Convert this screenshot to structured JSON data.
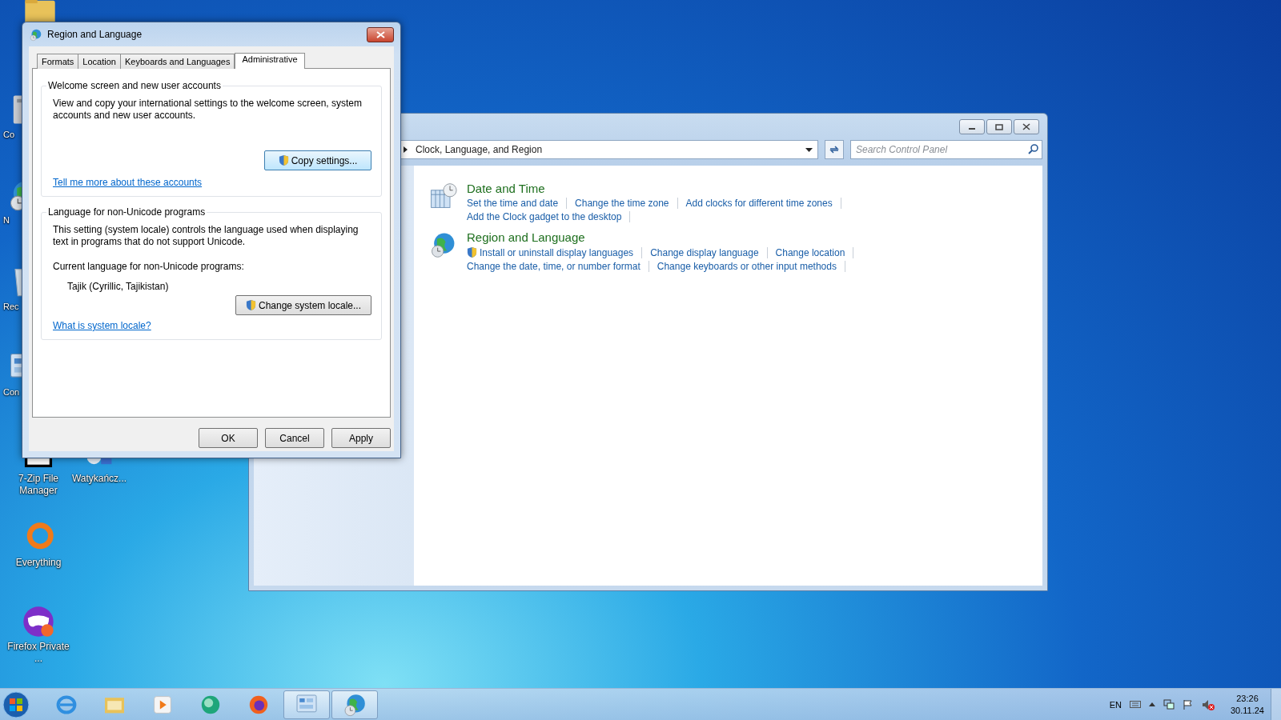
{
  "desktop_icons": [
    {
      "kind": "folder"
    },
    {
      "kind": "computer",
      "label": "Co"
    },
    {
      "kind": "globe",
      "label": "N"
    },
    {
      "kind": "bin",
      "label": "Rec"
    },
    {
      "kind": "panel",
      "label": "Con"
    },
    {
      "kind": "zip",
      "label": "7-Zip File Manager"
    },
    {
      "kind": "app",
      "label": "Watykańcz..."
    },
    {
      "kind": "ring",
      "label": "Everything"
    },
    {
      "kind": "mask",
      "label": "Firefox Private ..."
    }
  ],
  "dialog": {
    "title": "Region and Language",
    "tabs": [
      {
        "label": "Formats",
        "selected": false
      },
      {
        "label": "Location",
        "selected": false
      },
      {
        "label": "Keyboards and Languages",
        "selected": false
      },
      {
        "label": "Administrative",
        "selected": true
      }
    ],
    "groups": [
      {
        "heading": "Welcome screen and new user accounts",
        "description": "View and copy your international settings to the welcome screen, system accounts and new user accounts.",
        "button": "Copy settings...",
        "link": "Tell me more about these accounts"
      },
      {
        "heading": "Language for non-Unicode programs",
        "description": "This setting (system locale) controls the language used when displaying text in programs that do not support Unicode.",
        "current_label": "Current language for non-Unicode programs:",
        "current_value": "Tajik (Cyrillic, Tajikistan)",
        "button": "Change system locale...",
        "link": "What is system locale?"
      }
    ],
    "buttons": [
      "OK",
      "Cancel",
      "Apply"
    ]
  },
  "control_panel": {
    "breadcrumb": "Clock, Language, and Region",
    "search": {
      "placeholder": "Search Control Panel"
    },
    "categories": [
      {
        "kind": "clock",
        "title": "Date and Time",
        "link_rows": [
          [
            {
              "label": "Set the time and date",
              "shield": false
            },
            {
              "label": "Change the time zone",
              "shield": false
            },
            {
              "label": "Add clocks for different time zones",
              "shield": false
            }
          ],
          [
            {
              "label": "Add the Clock gadget to the desktop",
              "shield": false
            }
          ]
        ]
      },
      {
        "kind": "globe",
        "title": "Region and Language",
        "link_rows": [
          [
            {
              "label": "Install or uninstall display languages",
              "shield": true
            },
            {
              "label": "Change display language",
              "shield": false
            },
            {
              "label": "Change location",
              "shield": false
            }
          ],
          [
            {
              "label": "Change the date, time, or number format",
              "shield": false
            },
            {
              "label": "Change keyboards or other input methods",
              "shield": false
            }
          ]
        ]
      }
    ]
  },
  "taskbar": {
    "apps": [
      {
        "kind": "ie",
        "active": false
      },
      {
        "kind": "explorer",
        "active": false
      },
      {
        "kind": "media",
        "active": false
      },
      {
        "kind": "sphere",
        "active": false
      },
      {
        "kind": "firefox",
        "active": false
      },
      {
        "kind": "panel",
        "active": true
      },
      {
        "kind": "globe",
        "active": true
      }
    ],
    "language": "EN",
    "time": "23:26",
    "date": "30.11.24"
  }
}
